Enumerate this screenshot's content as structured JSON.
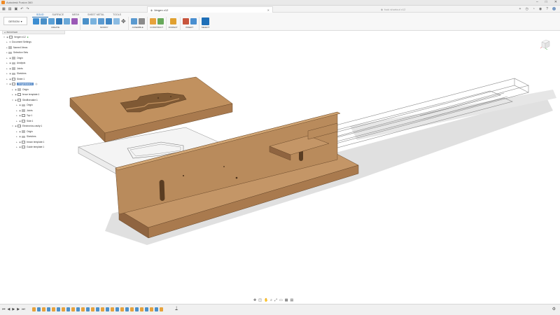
{
  "titlebar": {
    "app_title": "Autodesk Fusion 360"
  },
  "tabs": {
    "active": {
      "title": "Vergen v12"
    },
    "inactive": {
      "title": "fuck shortcut v12"
    }
  },
  "ribbon": {
    "workspace": "DESIGN",
    "tabs": [
      "SOLID",
      "SURFACE",
      "MESH",
      "SHEET METAL",
      "TOOLS"
    ],
    "groups": {
      "create": "CREATE",
      "modify": "MODIFY",
      "assemble": "ASSEMBLE",
      "construct": "CONSTRUCT",
      "inspect": "INSPECT",
      "insert": "INSERT",
      "select": "SELECT"
    }
  },
  "browser": {
    "header": "BROWSER",
    "items": [
      {
        "label": "Vergen v12"
      },
      {
        "label": "Document Settings"
      },
      {
        "label": "Named Views"
      },
      {
        "label": "Selection Sets"
      },
      {
        "label": "Origin"
      },
      {
        "label": "Analysis"
      },
      {
        "label": "Joints"
      },
      {
        "label": "Sketches"
      },
      {
        "label": "Sixter:1"
      },
      {
        "label": "Vergenbase:1"
      },
      {
        "label": "Origin"
      },
      {
        "label": "fence template:1"
      },
      {
        "label": "Sledfixenabe:1"
      },
      {
        "label": "Origin"
      },
      {
        "label": "Joints"
      },
      {
        "label": "Top:1"
      },
      {
        "label": "Side:1"
      },
      {
        "label": "Electronics.cavity:1"
      },
      {
        "label": "Origin"
      },
      {
        "label": "Sketches"
      },
      {
        "label": "brown template:1"
      },
      {
        "label": "Guide template:1"
      }
    ]
  },
  "colors": {
    "accent": "#1e6fb8",
    "mdf_top": "#c1915f",
    "mdf_front": "#a97a4e",
    "mdf_side": "#8f6440",
    "selected": "#5b8dc9"
  },
  "icons": {
    "save": "floppy-disk-icon",
    "undo": "undo-icon",
    "redo": "redo-icon",
    "select": "cursor-arrow-icon"
  }
}
